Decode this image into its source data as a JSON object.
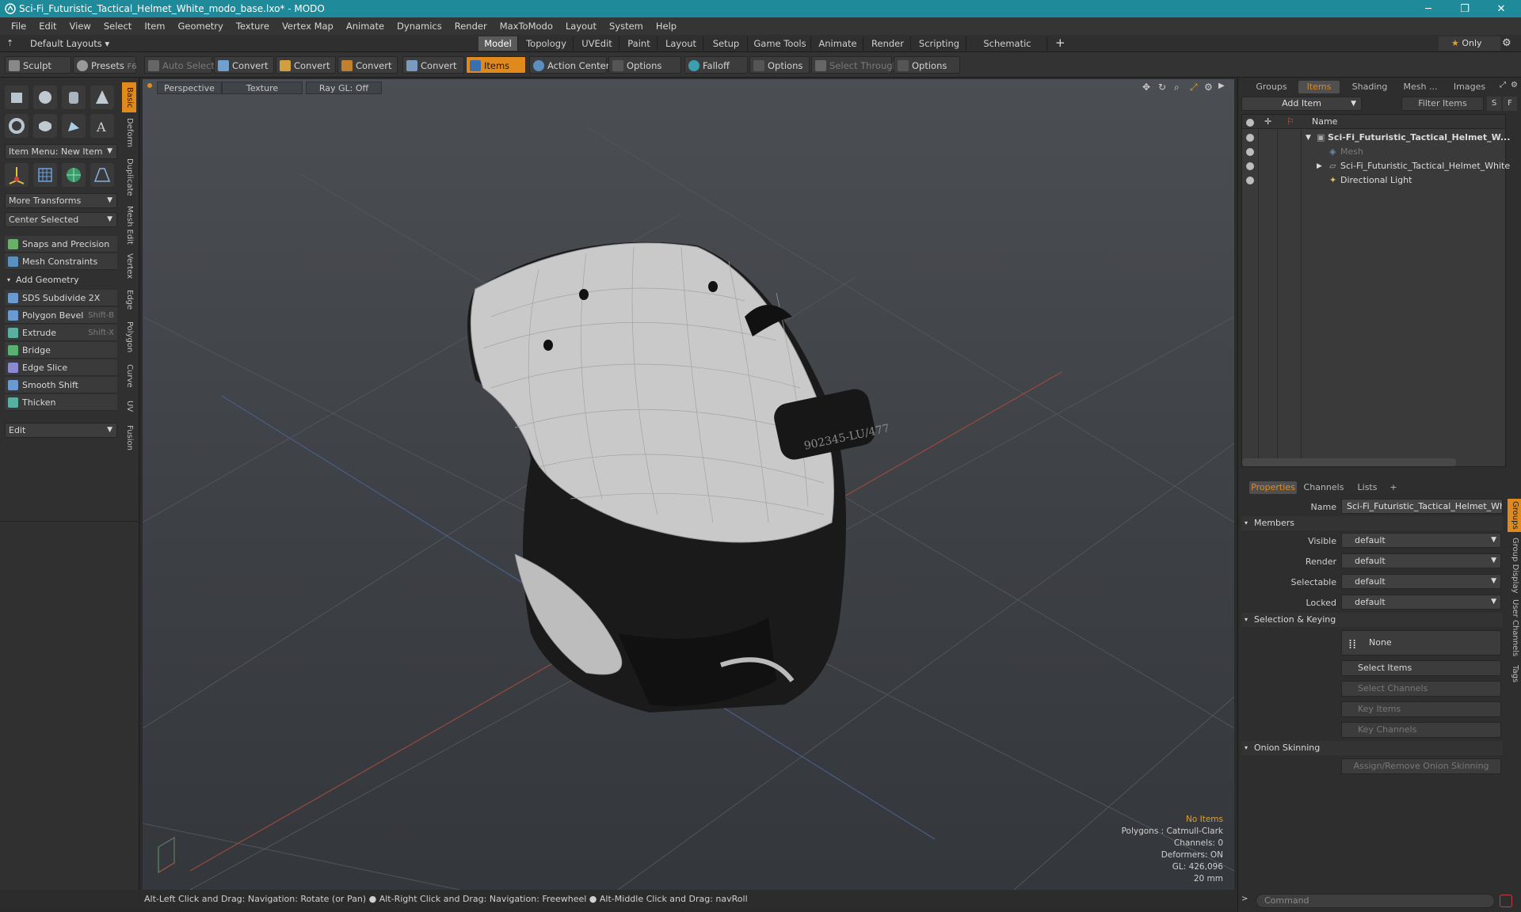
{
  "window": {
    "title": "Sci-Fi_Futuristic_Tactical_Helmet_White_modo_base.lxo* - MODO"
  },
  "menu": [
    "File",
    "Edit",
    "View",
    "Select",
    "Item",
    "Geometry",
    "Texture",
    "Vertex Map",
    "Animate",
    "Dynamics",
    "Render",
    "MaxToModo",
    "Layout",
    "System",
    "Help"
  ],
  "layouts": {
    "preset": "Default Layouts",
    "only_label": "Only",
    "tabs": [
      "Model",
      "Topology",
      "UVEdit",
      "Paint",
      "Layout",
      "Setup",
      "Game Tools",
      "Animate",
      "Render",
      "Scripting",
      "Schematic Fusion"
    ],
    "active": "Model"
  },
  "toolbar": {
    "sculpt": "Sculpt",
    "presets": "Presets",
    "presets_key": "F6",
    "auto_select": "Auto Select",
    "convert": "Convert",
    "items": "Items",
    "action_center": "Action Center",
    "options": "Options",
    "falloff": "Falloff",
    "select_through": "Select Through"
  },
  "leftpanel": {
    "item_menu": "Item Menu: New Item",
    "more_transforms": "More Transforms",
    "center_selected": "Center Selected",
    "snaps": "Snaps and Precision",
    "mesh_constraints": "Mesh Constraints",
    "add_geometry": "Add Geometry",
    "tools": [
      {
        "label": "SDS Subdivide 2X",
        "key": ""
      },
      {
        "label": "Polygon Bevel",
        "key": "Shift-B"
      },
      {
        "label": "Extrude",
        "key": "Shift-X"
      },
      {
        "label": "Bridge",
        "key": ""
      },
      {
        "label": "Edge Slice",
        "key": ""
      },
      {
        "label": "Smooth Shift",
        "key": ""
      },
      {
        "label": "Thicken",
        "key": ""
      }
    ],
    "edit": "Edit",
    "vtabs": [
      "Basic",
      "Deform",
      "Duplicate",
      "Mesh Edit",
      "Vertex",
      "Edge",
      "Polygon",
      "Curve",
      "UV",
      "Fusion"
    ]
  },
  "viewport": {
    "perspective": "Perspective",
    "texture": "Texture",
    "raygl": "Ray GL: Off",
    "decal_text": "902345-LU/477",
    "hud": {
      "selection": "No Items",
      "polygons": "Polygons : Catmull-Clark",
      "channels": "Channels: 0",
      "deformers": "Deformers: ON",
      "gl": "GL: 426,096",
      "scale": "20 mm"
    }
  },
  "status": {
    "hint1": "Alt-Left Click and Drag: Navigation: Rotate (or Pan)",
    "hint2": "Alt-Right Click and Drag: Navigation: Freewheel",
    "hint3": "Alt-Middle Click and Drag: navRoll"
  },
  "rightpanel": {
    "tabs": [
      "Groups",
      "Items",
      "Shading",
      "Mesh ...",
      "Images"
    ],
    "active_tab": "Items",
    "add_item": "Add Item",
    "filter_items": "Filter Items",
    "s_btn": "S",
    "f_btn": "F",
    "col_name": "Name",
    "tree": [
      {
        "label": "Sci-Fi_Futuristic_Tactical_Helmet_W...",
        "indent": 0
      },
      {
        "label": "Mesh",
        "indent": 1
      },
      {
        "label": "Sci-Fi_Futuristic_Tactical_Helmet_White",
        "indent": 1
      },
      {
        "label": "Directional Light",
        "indent": 1
      }
    ],
    "ptabs": [
      "Properties",
      "Channels",
      "Lists"
    ],
    "ptab_plus": "+",
    "props": {
      "name_label": "Name",
      "name_value": "Sci-Fi_Futuristic_Tactical_Helmet_White",
      "members": "Members",
      "visible_label": "Visible",
      "visible": "default",
      "render_label": "Render",
      "render": "default",
      "selectable_label": "Selectable",
      "selectable": "default",
      "locked_label": "Locked",
      "locked": "default",
      "sel_keying": "Selection & Keying",
      "none": "None",
      "select_items": "Select Items",
      "select_channels": "Select Channels",
      "key_items": "Key Items",
      "key_channels": "Key Channels",
      "onion": "Onion Skinning",
      "assign_onion": "Assign/Remove Onion Skinning"
    },
    "side_tabs": [
      "Groups",
      "Group Display",
      "User Channels",
      "Tags"
    ],
    "command_placeholder": "Command"
  },
  "colors": {
    "accent": "#e08a1e",
    "titlebar": "#1f8a9a"
  }
}
